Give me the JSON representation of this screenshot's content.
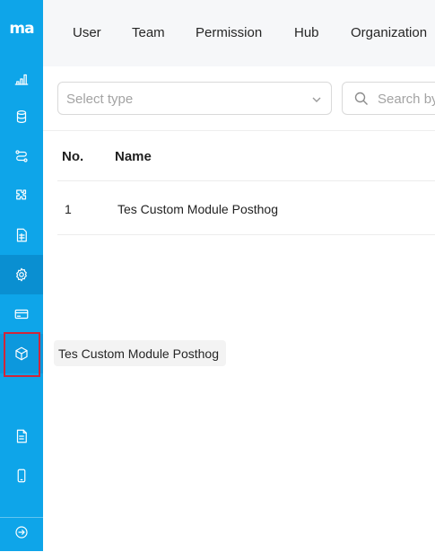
{
  "app": {
    "logo_text": "ma"
  },
  "sidebar": {
    "items": [
      {
        "icon": "bar-chart-icon"
      },
      {
        "icon": "database-icon"
      },
      {
        "icon": "workflow-icon"
      },
      {
        "icon": "puzzle-icon"
      },
      {
        "icon": "spreadsheet-icon"
      },
      {
        "icon": "gear-icon",
        "active": true
      },
      {
        "icon": "credit-card-icon"
      },
      {
        "icon": "cube-icon",
        "highlighted": true
      },
      {
        "icon": "document-icon"
      },
      {
        "icon": "mobile-icon"
      },
      {
        "icon": "arrow-right-circle-icon"
      }
    ],
    "tooltip": "Tes Custom Module Posthog",
    "highlight_color": "#d0263a",
    "accent": "#0ea5e9"
  },
  "tabs": [
    "User",
    "Team",
    "Permission",
    "Hub",
    "Organization"
  ],
  "filters": {
    "type_placeholder": "Select type",
    "search_placeholder": "Search by"
  },
  "table": {
    "columns": [
      "No.",
      "Name"
    ],
    "rows": [
      {
        "no": "1",
        "name": "Tes Custom Module Posthog"
      }
    ]
  }
}
